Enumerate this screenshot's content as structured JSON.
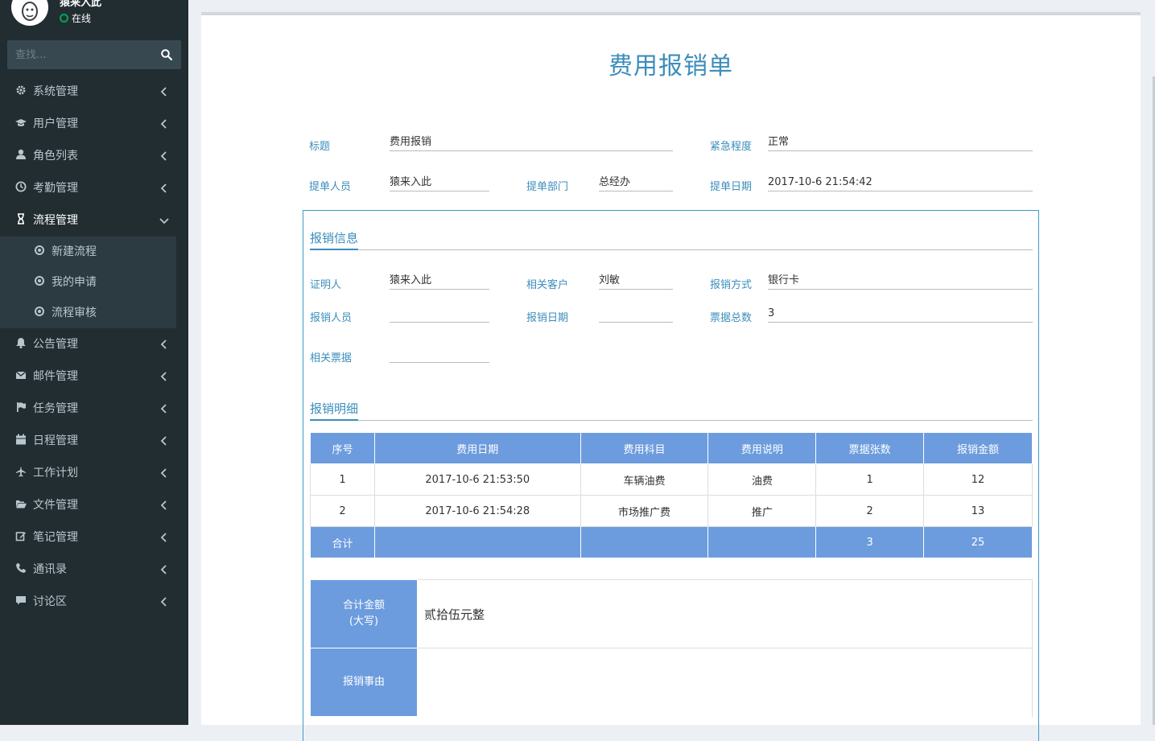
{
  "sidebar": {
    "user_name": "猿来入此",
    "user_status": "在线",
    "search_placeholder": "查找...",
    "menu": [
      {
        "label": "系统管理",
        "icon": "gear-icon"
      },
      {
        "label": "用户管理",
        "icon": "graduation-cap-icon"
      },
      {
        "label": "角色列表",
        "icon": "user-icon"
      },
      {
        "label": "考勤管理",
        "icon": "clock-icon"
      },
      {
        "label": "流程管理",
        "icon": "hourglass-icon"
      },
      {
        "label": "公告管理",
        "icon": "bell-icon"
      },
      {
        "label": "邮件管理",
        "icon": "envelope-icon"
      },
      {
        "label": "任务管理",
        "icon": "flag-icon"
      },
      {
        "label": "日程管理",
        "icon": "calendar-icon"
      },
      {
        "label": "工作计划",
        "icon": "plane-icon"
      },
      {
        "label": "文件管理",
        "icon": "folder-open-icon"
      },
      {
        "label": "笔记管理",
        "icon": "edit-icon"
      },
      {
        "label": "通讯录",
        "icon": "phone-icon"
      },
      {
        "label": "讨论区",
        "icon": "comment-icon"
      }
    ],
    "submenu": [
      {
        "label": "新建流程"
      },
      {
        "label": "我的申请"
      },
      {
        "label": "流程审核"
      }
    ]
  },
  "form": {
    "title": "费用报销单",
    "fields": {
      "title_label": "标题",
      "title_value": "费用报销",
      "urgency_label": "紧急程度",
      "urgency_value": "正常",
      "applicant_label": "提单人员",
      "applicant_value": "猿来入此",
      "dept_label": "提单部门",
      "dept_value": "总经办",
      "date_label": "提单日期",
      "date_value": "2017-10-6 21:54:42"
    },
    "info": {
      "section_title": "报销信息",
      "witness_label": "证明人",
      "witness_value": "猿来入此",
      "customer_label": "相关客户",
      "customer_value": "刘敏",
      "method_label": "报销方式",
      "method_value": "银行卡",
      "reimburser_label": "报销人员",
      "reimburser_value": "",
      "reimburse_date_label": "报销日期",
      "reimburse_date_value": "",
      "receipt_total_label": "票据总数",
      "receipt_total_value": "3",
      "related_receipts_label": "相关票据",
      "related_receipts_value": ""
    },
    "detail": {
      "section_title": "报销明细",
      "headers": [
        "序号",
        "费用日期",
        "费用科目",
        "费用说明",
        "票据张数",
        "报销金额"
      ],
      "rows": [
        [
          "1",
          "2017-10-6 21:53:50",
          "车辆油费",
          "油费",
          "1",
          "12"
        ],
        [
          "2",
          "2017-10-6 21:54:28",
          "市场推广费",
          "推广",
          "2",
          "13"
        ]
      ],
      "total_row": [
        "合计",
        "",
        "",
        "",
        "3",
        "25"
      ]
    },
    "summary": {
      "amount_label_line1": "合计金额",
      "amount_label_line2": "(大写)",
      "amount_value": "贰拾伍元整",
      "reason_label": "报销事由",
      "reason_value": ""
    }
  },
  "colors": {
    "sidebar_bg": "#222d32",
    "accent": "#3c8dbc",
    "table_header": "#6c9cde",
    "status_online": "#00a65a"
  }
}
